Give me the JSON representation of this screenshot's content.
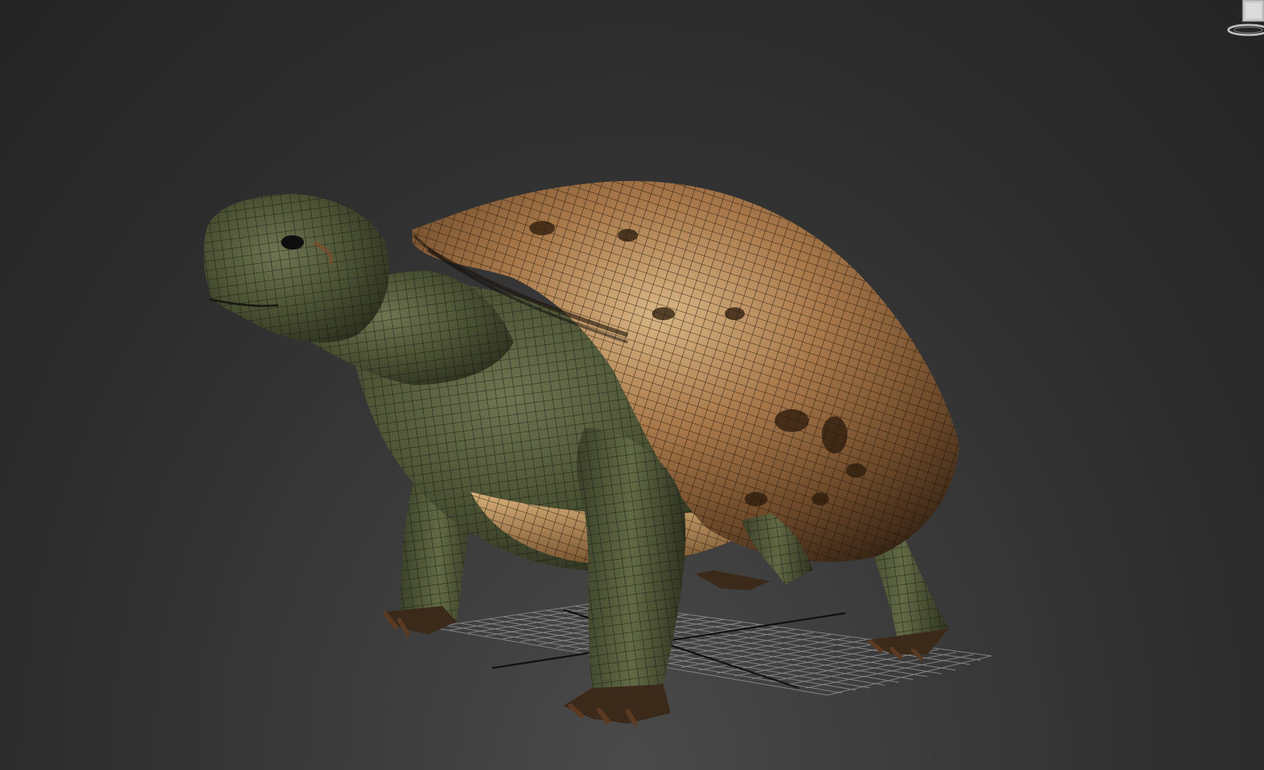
{
  "viewport": {
    "background_color": "#2e2e2e",
    "grid_color": "#9a9a9a",
    "model": "turtle",
    "shading": "textured-with-wireframe"
  },
  "viewcube": {
    "icon": "viewcube-icon"
  }
}
